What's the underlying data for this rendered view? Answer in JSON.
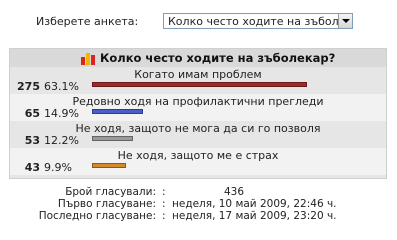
{
  "selector": {
    "label": "Изберете анкета:",
    "value": "Колко често ходите на зъболек"
  },
  "poll": {
    "title": "Колко често ходите на зъболекар?",
    "options": [
      {
        "label": "Когато имам проблем",
        "count": "275",
        "pct": "63.1%",
        "fraction": 0.631,
        "color": "#a0282d"
      },
      {
        "label": "Редовно ходя на профилактични прегледи",
        "count": "65",
        "pct": "14.9%",
        "fraction": 0.149,
        "color": "#4660c8"
      },
      {
        "label": "Не ходя, защото не мога да си го позволя",
        "count": "53",
        "pct": "12.2%",
        "fraction": 0.122,
        "color": "#9a9a9a"
      },
      {
        "label": "Не ходя, защото ме е страх",
        "count": "43",
        "pct": "9.9%",
        "fraction": 0.099,
        "color": "#d38a2b"
      }
    ]
  },
  "stats": {
    "votes_label": "Брой гласували:",
    "votes_value": "436",
    "first_label": "Първо гласуване:",
    "first_value": "неделя, 10 май 2009, 22:46 ч.",
    "last_label": "Последно гласуване:",
    "last_value": "неделя, 17 май 2009, 23:20 ч."
  }
}
